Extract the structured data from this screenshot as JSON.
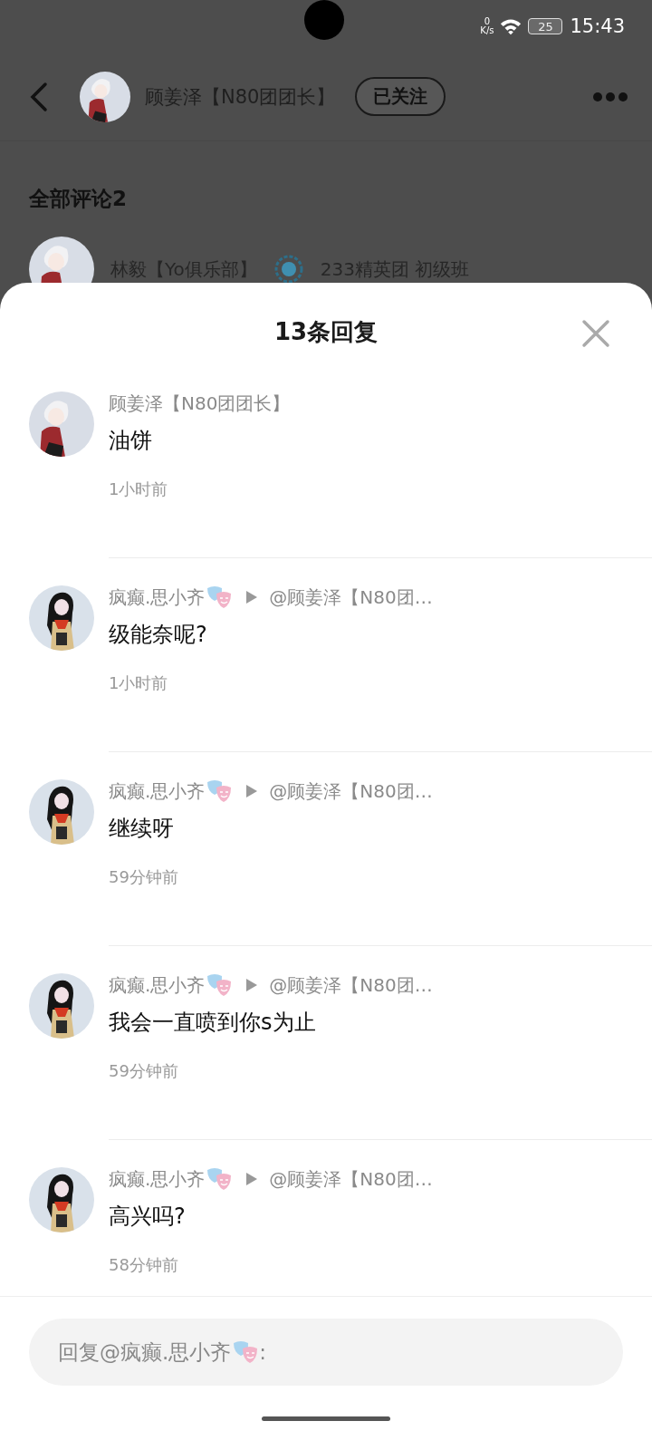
{
  "status_bar": {
    "net_speed": "0",
    "net_unit": "K/s",
    "battery": "25",
    "time": "15:43"
  },
  "background_page": {
    "author": "顾姜泽【N80团团长】",
    "follow_button": "已关注",
    "comments_heading": "全部评论2",
    "first_comment": {
      "author": "林毅【Yo俱乐部】",
      "group": "233精英团 初级班"
    }
  },
  "replies_sheet": {
    "title": "13条回复",
    "replies": [
      {
        "author": "顾姜泽【N80团团长】",
        "mask_badge": false,
        "text": "油饼",
        "time": "1小时前"
      },
      {
        "author": "疯癫.思小齐",
        "mask_badge": true,
        "reply_to": "@顾姜泽【N80团…",
        "text": "级能奈呢?",
        "time": "1小时前"
      },
      {
        "author": "疯癫.思小齐",
        "mask_badge": true,
        "reply_to": "@顾姜泽【N80团…",
        "text": "继续呀",
        "time": "59分钟前"
      },
      {
        "author": "疯癫.思小齐",
        "mask_badge": true,
        "reply_to": "@顾姜泽【N80团…",
        "text": "我会一直喷到你s为止",
        "time": "59分钟前"
      },
      {
        "author": "疯癫.思小齐",
        "mask_badge": true,
        "reply_to": "@顾姜泽【N80团…",
        "text": "高兴吗?",
        "time": "58分钟前"
      }
    ],
    "reply_box": {
      "prompt_prefix": "回复@疯癫.思小齐",
      "mask_badge": true,
      "prompt_suffix": ":"
    }
  }
}
